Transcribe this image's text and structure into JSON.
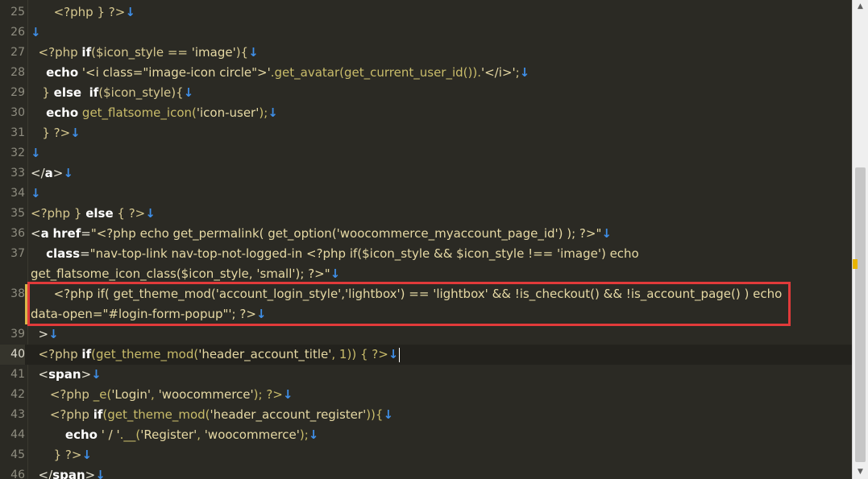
{
  "lines": [
    {
      "num": "25",
      "html": "      <span class='p'>&lt;?php</span> <span class='p'>} ?&gt;</span><span class='arr'>↓</span>"
    },
    {
      "num": "26",
      "html": "<span class='arr'>↓</span>"
    },
    {
      "num": "27",
      "html": "  <span class='p'>&lt;?php</span> <span class='k'>if</span><span class='p'>($icon_style == </span><span class='s'>'image'</span><span class='p'>){</span><span class='arr'>↓</span>"
    },
    {
      "num": "28",
      "html": "    <span class='k'>echo</span> <span class='s'>'&lt;i class=\"image-icon circle\"&gt;'</span><span class='f'>.get_avatar(get_current_user_id()).</span><span class='s'>'&lt;/i&gt;'</span><span class='p'>;</span><span class='arr'>↓</span>"
    },
    {
      "num": "29",
      "html": "   <span class='p'>}</span> <span class='k'>else</span>  <span class='k'>if</span><span class='p'>($icon_style){</span><span class='arr'>↓</span>"
    },
    {
      "num": "30",
      "html": "    <span class='k'>echo</span> <span class='f'>get_flatsome_icon(</span><span class='s'>'icon-user'</span><span class='f'>);</span><span class='arr'>↓</span>"
    },
    {
      "num": "31",
      "html": "   <span class='p'>} ?&gt;</span><span class='arr'>↓</span>"
    },
    {
      "num": "32",
      "html": "<span class='arr'>↓</span>"
    },
    {
      "num": "33",
      "html": "<span class='a'>&lt;/</span><span class='k'>a</span><span class='a'>&gt;</span><span class='arr'>↓</span>"
    },
    {
      "num": "34",
      "html": "<span class='arr'>↓</span>"
    },
    {
      "num": "35",
      "html": "<span class='p'>&lt;?php</span> <span class='p'>}</span> <span class='k'>else</span> <span class='p'>{ ?&gt;</span><span class='arr'>↓</span>"
    },
    {
      "num": "36",
      "html": "<span class='a'>&lt;</span><span class='k'>a</span> <span class='k'>href</span><span class='a'>=</span><span class='s'>\"&lt;?php echo get_permalink( get_option('woocommerce_myaccount_page_id') ); ?&gt;\"</span><span class='arr'>↓</span>"
    },
    {
      "num": "37",
      "html": "    <span class='k'>class</span><span class='a'>=</span><span class='s'>\"nav-top-link nav-top-not-logged-in &lt;?php if($icon_style &amp;&amp; $icon_style !== 'image') echo</span>"
    },
    {
      "num": "",
      "html": "<span class='s'>get_flatsome_icon_class($icon_style, 'small'); ?&gt;\"</span><span class='arr'>↓</span>"
    },
    {
      "num": "38",
      "html": "      <span class='s'>&lt;?php if( get_theme_mod('account_login_style','lightbox') == 'lightbox' &amp;&amp; !is_checkout() &amp;&amp; !is_account_page() ) echo</span>"
    },
    {
      "num": "",
      "html": "<span class='s'>data-open=\"#login-form-popup\"'; ?&gt;</span><span class='arr'>↓</span>"
    },
    {
      "num": "39",
      "html": "  <span class='a'>&gt;</span><span class='arr'>↓</span>"
    },
    {
      "num": "40",
      "html": "  <span class='p'>&lt;?php</span> <span class='k'>if</span><span class='f'>(get_theme_mod(</span><span class='s'>'header_account_title'</span><span class='f'>, 1)) { ?&gt;</span><span class='arr'>↓</span><span class='caret'></span>"
    },
    {
      "num": "41",
      "html": "  <span class='a'>&lt;</span><span class='k'>span</span><span class='a'>&gt;</span><span class='arr'>↓</span>"
    },
    {
      "num": "42",
      "html": "     <span class='p'>&lt;?php</span> <span class='f'>_e(</span><span class='s'>'Login'</span><span class='f'>, </span><span class='s'>'woocommerce'</span><span class='f'>); ?&gt;</span><span class='arr'>↓</span>"
    },
    {
      "num": "43",
      "html": "     <span class='p'>&lt;?php</span> <span class='k'>if</span><span class='f'>(get_theme_mod(</span><span class='s'>'header_account_register'</span><span class='f'>)){</span><span class='arr'>↓</span>"
    },
    {
      "num": "44",
      "html": "         <span class='k'>echo</span> <span class='s'>' / '</span><span class='f'>.__(</span><span class='s'>'Register'</span><span class='f'>, </span><span class='s'>'woocommerce'</span><span class='f'>);</span><span class='arr'>↓</span>"
    },
    {
      "num": "45",
      "html": "      <span class='p'>} ?&gt;</span><span class='arr'>↓</span>"
    },
    {
      "num": "46",
      "html": "  <span class='a'>&lt;/</span><span class='k'>span</span><span class='a'>&gt;</span><span class='arr'>↓</span>"
    }
  ],
  "current_line": "40",
  "bookmark_line": "38",
  "highlight": {
    "color": "#e13a3a",
    "label": "highlighted-code-line-38"
  },
  "scrollbar": {
    "up_glyph": "▲",
    "down_glyph": "▼"
  }
}
